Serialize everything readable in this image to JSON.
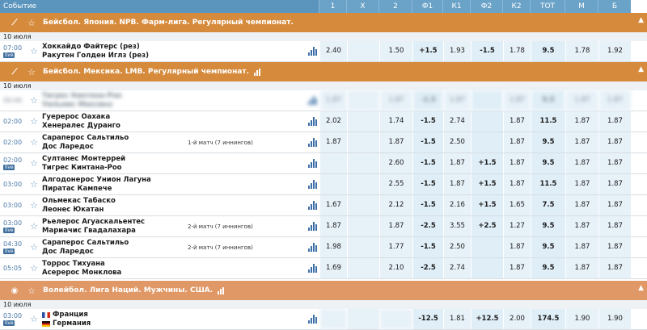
{
  "header": {
    "event": "Событие",
    "cols": [
      "1",
      "X",
      "2",
      "Ф1",
      "К1",
      "Ф2",
      "К2",
      "ТОТ",
      "М",
      "Б"
    ]
  },
  "sections": [
    {
      "title": "Бейсбол. Япония. NPB. Фарм-лига. Регулярный чемпионат.",
      "icon": "baseball-bat-icon",
      "date": "10 июля",
      "rows": [
        {
          "time": "07:00",
          "live": "live",
          "team1": "Хоккайдо Файтерс (рез)",
          "team2": "Ракутен Голден Иглз (рез)",
          "note": "",
          "odds": [
            "2.40",
            "",
            "1.50",
            "+1.5",
            "1.93",
            "-1.5",
            "1.78",
            "9.5",
            "1.78",
            "1.92"
          ]
        }
      ]
    },
    {
      "title": "Бейсбол. Мексика. LMB. Регулярный чемпионат.",
      "icon": "baseball-bat-icon",
      "date": "10 июля",
      "rows": [
        {
          "time": "00:00",
          "live": "",
          "team1": "Тигрес Кинтана-Роо",
          "team2": "Уильямс Мексико",
          "note": "",
          "blurred": true,
          "odds": [
            "1.87",
            "",
            "1.87",
            "-1.5",
            "1.87",
            "",
            "1.87",
            "9.5",
            "1.87",
            "1.87"
          ]
        },
        {
          "time": "02:00",
          "live": "",
          "team1": "Гуерерос Оахака",
          "team2": "Хенералес Дуранго",
          "note": "",
          "odds": [
            "2.02",
            "",
            "1.74",
            "-1.5",
            "2.74",
            "",
            "1.87",
            "11.5",
            "1.87",
            "1.87"
          ]
        },
        {
          "time": "02:00",
          "live": "",
          "team1": "Сарaперос Сальтильо",
          "team2": "Дос Ларедос",
          "note": "1-й матч (7 иннингов)",
          "odds": [
            "1.87",
            "",
            "1.87",
            "-1.5",
            "2.50",
            "",
            "1.87",
            "9.5",
            "1.87",
            "1.87"
          ]
        },
        {
          "time": "02:00",
          "live": "live",
          "team1": "Султанес Монтеррей",
          "team2": "Тигрес Кинтана-Роо",
          "note": "",
          "odds": [
            "",
            "",
            "2.60",
            "-1.5",
            "1.87",
            "+1.5",
            "1.87",
            "9.5",
            "1.87",
            "1.87"
          ]
        },
        {
          "time": "03:00",
          "live": "",
          "team1": "Алгодонерос Унион Лагуна",
          "team2": "Пиратас Кампече",
          "note": "",
          "odds": [
            "",
            "",
            "2.55",
            "-1.5",
            "1.87",
            "+1.5",
            "1.87",
            "11.5",
            "1.87",
            "1.87"
          ]
        },
        {
          "time": "03:00",
          "live": "",
          "team1": "Ольмекас Табаско",
          "team2": "Леонес Юкатан",
          "note": "",
          "odds": [
            "1.67",
            "",
            "2.12",
            "-1.5",
            "2.16",
            "+1.5",
            "1.65",
            "7.5",
            "1.87",
            "1.87"
          ]
        },
        {
          "time": "03:00",
          "live": "live",
          "team1": "Рьелерос Агуаскальентес",
          "team2": "Мариачис Гвадалахара",
          "note": "2-й матч (7 иннингов)",
          "odds": [
            "1.87",
            "",
            "1.87",
            "-2.5",
            "3.55",
            "+2.5",
            "1.27",
            "9.5",
            "1.87",
            "1.87"
          ]
        },
        {
          "time": "04:30",
          "live": "live",
          "team1": "Сарaперос Сальтильо",
          "team2": "Дос Ларедос",
          "note": "2-й матч (7 иннингов)",
          "odds": [
            "1.98",
            "",
            "1.77",
            "-1.5",
            "2.50",
            "",
            "1.87",
            "9.5",
            "1.87",
            "1.87"
          ]
        },
        {
          "time": "05:05",
          "live": "",
          "team1": "Торрос Тихуана",
          "team2": "Асерерос Монклова",
          "note": "",
          "odds": [
            "1.69",
            "",
            "2.10",
            "-2.5",
            "2.74",
            "",
            "1.87",
            "9.5",
            "1.87",
            "1.87"
          ]
        }
      ]
    },
    {
      "title": "Волейбол. Лига Наций. Мужчины. США.",
      "icon": "volleyball-icon",
      "date": "10 июля",
      "rows": [
        {
          "time": "03:00",
          "live": "live",
          "team1": "Франция",
          "team2": "Германия",
          "flags": true,
          "note": "",
          "odds": [
            "",
            "",
            "",
            "-12.5",
            "1.81",
            "+12.5",
            "2.00",
            "174.5",
            "1.90",
            "1.90"
          ]
        }
      ]
    }
  ],
  "colors": {
    "header": "#6aa2c8",
    "section_orange": "#d68a3c",
    "section_salmon": "#df9866",
    "accent": "#3c6fa8"
  }
}
